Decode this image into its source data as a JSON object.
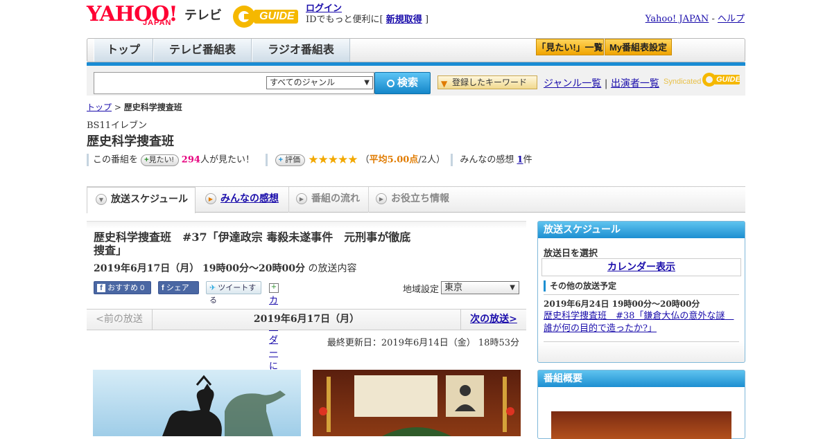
{
  "header": {
    "logo_yahoo": "YAHOO!",
    "logo_japan": "JAPAN",
    "logo_tv": "テレビ",
    "logo_gguide": "GUIDE",
    "login_label": "ログイン",
    "login_tagline": "IDでもっと便利に[",
    "register_label": "新規取得",
    "register_suffix": "]",
    "yahoo_japan_link": "Yahoo! JAPAN",
    "separator": "-",
    "help_link": "ヘルプ"
  },
  "nav": {
    "tabs": [
      "トップ",
      "テレビ番組表",
      "ラジオ番組表"
    ],
    "want_list_button": "「見たい!」一覧",
    "my_schedule_button": "My番組表設定"
  },
  "search": {
    "placeholder": "",
    "genre_selected": "すべてのジャンル",
    "search_button": "検索",
    "keyword_button": "登録したキーワード",
    "genre_list_link": "ジャンル一覧",
    "link_separator": "|",
    "performer_list_link": "出演者一覧",
    "syndicated_text": "Syndicated",
    "syndicated_logo": "GUIDE"
  },
  "breadcrumb": {
    "top": "トップ",
    "sep": ">",
    "current": "歴史科学捜査班"
  },
  "program": {
    "channel": "BS11イレブン",
    "title": "歴史科学捜査班",
    "want_prefix": "この番組を",
    "want_button": "見たい!",
    "want_count": "294",
    "want_suffix": "人が見たい！",
    "rating_button": "評価",
    "stars": "★★★★★",
    "rating_open": "（",
    "rating_avg": "平均5.00点",
    "rating_count": "/2人）",
    "impressions_label": "みんなの感想",
    "impressions_count": "1",
    "impressions_suffix": "件"
  },
  "content_tabs": [
    "放送スケジュール",
    "みんなの感想",
    "番組の流れ",
    "お役立ち情報"
  ],
  "episode": {
    "title": "歴史科学捜査班　#37「伊達政宗 毒殺未遂事件　元刑事が徹底捜査」",
    "datetime": "2019年6月17日（月） 19時00分～20時00分",
    "datetime_suffix": "の放送内容",
    "fb_recommend": "おすすめ",
    "fb_count": "0",
    "fb_share": "シェア",
    "tweet": "ツイートする",
    "calendar_register": "カレンダーに登録",
    "region_label": "地域設定",
    "region_selected": "東京"
  },
  "pager": {
    "prev": "<前の放送",
    "date": "2019年6月17日（月）",
    "next": "次の放送>"
  },
  "updated": "最終更新日：2019年6月14日（金） 18時53分",
  "sidebar": {
    "schedule_title": "放送スケジュール",
    "select_date": "放送日を選択",
    "calendar_button": "カレンダー表示",
    "other_schedule": "その他の放送予定",
    "other_date": "2019年6月24日 19時00分～20時00分",
    "other_link": "歴史科学捜査班　#38「鎌倉大仏の意外な謎　誰が何の目的で造ったか?」",
    "summary_title": "番組概要"
  }
}
